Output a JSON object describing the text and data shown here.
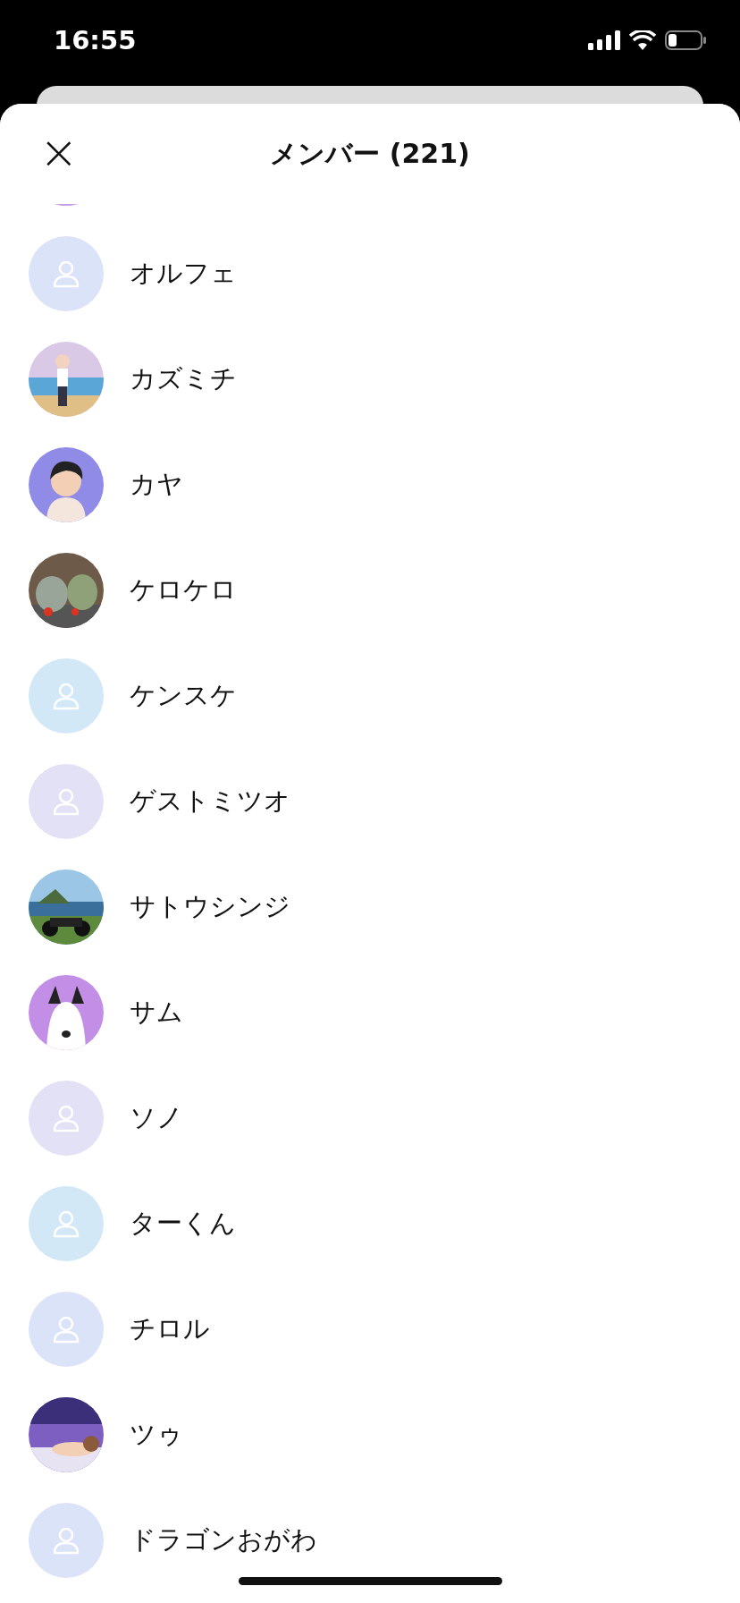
{
  "status_bar": {
    "time": "16:55"
  },
  "header": {
    "close": "×",
    "title": "メンバー (221)"
  },
  "members": [
    {
      "kind": "picture",
      "color": "#c79be6"
    },
    {
      "kind": "placeholder",
      "name": "オルフェ",
      "color": "#dbe3f8"
    },
    {
      "kind": "picture",
      "name": "カズミチ"
    },
    {
      "kind": "picture",
      "name": "カヤ"
    },
    {
      "kind": "picture",
      "name": "ケロケロ"
    },
    {
      "kind": "placeholder",
      "name": "ケンスケ",
      "color": "#d3e8f6"
    },
    {
      "kind": "placeholder",
      "name": "ゲストミツオ",
      "color": "#e2e1f6"
    },
    {
      "kind": "picture",
      "name": "サトウシンジ"
    },
    {
      "kind": "picture",
      "name": "サム"
    },
    {
      "kind": "placeholder",
      "name": "ソノ",
      "color": "#e2e1f6"
    },
    {
      "kind": "placeholder",
      "name": "ターくん",
      "color": "#d3e8f6"
    },
    {
      "kind": "placeholder",
      "name": "チロル",
      "color": "#dbe3f8"
    },
    {
      "kind": "picture",
      "name": "ツゥ"
    },
    {
      "kind": "placeholder",
      "name": "ドラゴンおがわ",
      "color": "#dbe3f8"
    }
  ]
}
